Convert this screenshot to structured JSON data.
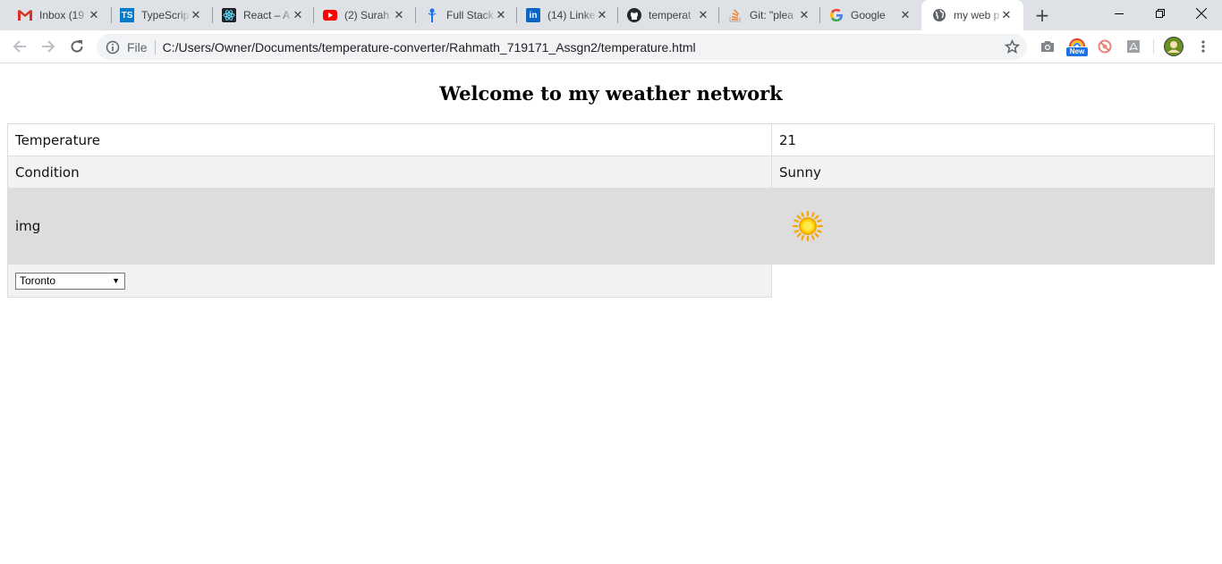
{
  "browser": {
    "tabs": [
      {
        "title": "Inbox (19",
        "icon": "gmail-icon"
      },
      {
        "title": "TypeScrip",
        "icon": "typescript-icon"
      },
      {
        "title": "React – A",
        "icon": "react-icon"
      },
      {
        "title": "(2) Surah",
        "icon": "youtube-icon"
      },
      {
        "title": "Full Stack",
        "icon": "fullstack-icon"
      },
      {
        "title": "(14) Linke",
        "icon": "linkedin-icon"
      },
      {
        "title": "temperat",
        "icon": "github-icon"
      },
      {
        "title": "Git: \"plea",
        "icon": "stackoverflow-icon"
      },
      {
        "title": "Google",
        "icon": "google-icon"
      },
      {
        "title": "my web p",
        "icon": "globe-icon"
      }
    ],
    "omnibox": {
      "scheme": "File",
      "url": "C:/Users/Owner/Documents/temperature-converter/Rahmath_719171_Assgn2/temperature.html"
    },
    "extension_badge": "New"
  },
  "page": {
    "title": "Welcome to my weather network",
    "rows": {
      "temperature": {
        "label": "Temperature",
        "value": "21"
      },
      "condition": {
        "label": "Condition",
        "value": "Sunny"
      },
      "image": {
        "label": "img",
        "icon": "sun-icon"
      }
    },
    "city_select": {
      "selected": "Toronto"
    }
  }
}
